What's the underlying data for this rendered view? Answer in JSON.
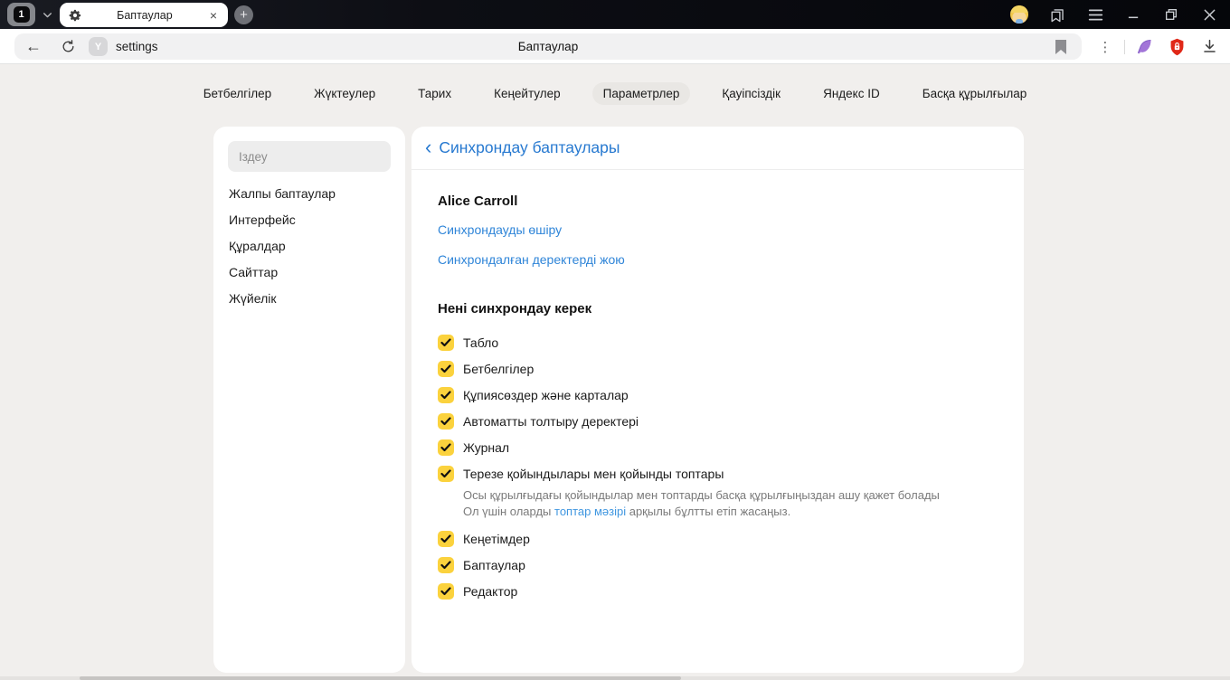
{
  "browser": {
    "tab_count": "1",
    "active_tab_title": "Баптаулар",
    "close_tab_glyph": "×",
    "new_tab_glyph": "+",
    "page_title": "Баптаулар",
    "url": "settings",
    "site_badge_glyph": "Y",
    "back_glyph": "←",
    "kebab_glyph": "⋮"
  },
  "nav": {
    "items": [
      {
        "label": "Бетбелгілер"
      },
      {
        "label": "Жүктеулер"
      },
      {
        "label": "Тарих"
      },
      {
        "label": "Кеңейтулер"
      },
      {
        "label": "Параметрлер"
      },
      {
        "label": "Қауіпсіздік"
      },
      {
        "label": "Яндекс ID"
      },
      {
        "label": "Басқа құрылғылар"
      }
    ],
    "active": "Параметрлер"
  },
  "sidebar": {
    "search_placeholder": "Іздеу",
    "items": [
      {
        "label": "Жалпы баптаулар"
      },
      {
        "label": "Интерфейс"
      },
      {
        "label": "Құралдар"
      },
      {
        "label": "Сайттар"
      },
      {
        "label": "Жүйелік"
      }
    ]
  },
  "main": {
    "back_glyph": "‹",
    "title": "Синхрондау баптаулары",
    "account_name": "Alice Carroll",
    "link_disable_sync": "Синхрондауды өшіру",
    "link_delete_synced": "Синхрондалған деректерді жою",
    "section_title": "Нені синхрондау керек",
    "items": [
      {
        "label": "Табло",
        "checked": true
      },
      {
        "label": "Бетбелгілер",
        "checked": true
      },
      {
        "label": "Құпиясөздер және карталар",
        "checked": true
      },
      {
        "label": "Автоматты толтыру деректері",
        "checked": true
      },
      {
        "label": "Журнал",
        "checked": true
      },
      {
        "label": "Терезе қойындылары мен қойынды топтары",
        "checked": true,
        "description_line1": "Осы құрылғыдағы қойындылар мен топтарды басқа құрылғыңыздан ашу қажет болады",
        "description_line2_prefix": "Ол үшін оларды ",
        "description_link": "топтар мәзірі",
        "description_line2_suffix": " арқылы бұлтты етіп жасаңыз."
      },
      {
        "label": "Кеңетімдер",
        "checked": true
      },
      {
        "label": "Баптаулар",
        "checked": true
      },
      {
        "label": "Редактор",
        "checked": true
      }
    ]
  },
  "colors": {
    "accent_blue": "#2779d0",
    "inline_link_blue": "#3f96e0",
    "checkbox_yellow": "#fbd23d",
    "protect_red": "#e02818",
    "feather_purple": "#9a6fd0"
  }
}
